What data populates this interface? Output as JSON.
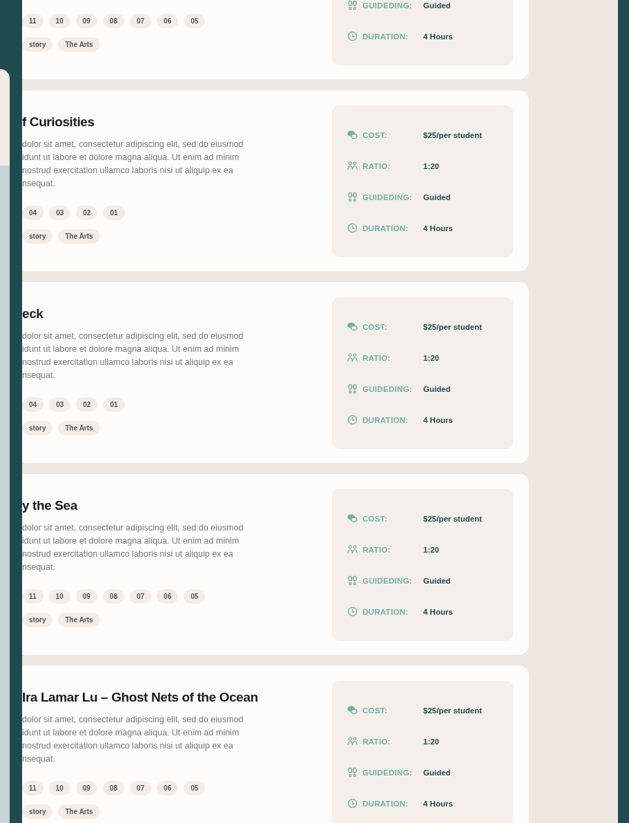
{
  "cards": [
    {
      "numbers": [
        "11",
        "10",
        "09",
        "08",
        "07",
        "06",
        "05"
      ],
      "tags": [
        "story",
        "The Arts"
      ],
      "details": [
        {
          "kind": "guided",
          "label": "GUIDEDING:",
          "value": "Guided"
        },
        {
          "kind": "duration",
          "label": "DURATION:",
          "value": "4 Hours"
        }
      ]
    },
    {
      "title": "f Curiosities",
      "description": "dolor sit amet, consectetur adipiscing elit, sed do eiusmod\nidunt ut labore et dolore magna aliqua. Ut enim ad minim\nnostrud exercitation ullamco laboris nisi ut aliquip ex ea\nnsequat.",
      "numbers": [
        "04",
        "03",
        "02",
        "01"
      ],
      "tags": [
        "story",
        "The Arts"
      ],
      "details": [
        {
          "kind": "cost",
          "label": "COST:",
          "value": "$25/per student"
        },
        {
          "kind": "ratio",
          "label": "RATIO:",
          "value": "1:20"
        },
        {
          "kind": "guided",
          "label": "GUIDEDING:",
          "value": "Guided"
        },
        {
          "kind": "duration",
          "label": "DURATION:",
          "value": "4 Hours"
        }
      ]
    },
    {
      "title": "eck",
      "description": "dolor sit amet, consectetur adipiscing elit, sed do eiusmod\nidunt ut labore et dolore magna aliqua. Ut enim ad minim\nnostrud exercitation ullamco laboris nisi ut aliquip ex ea\nnsequat.",
      "numbers": [
        "04",
        "03",
        "02",
        "01"
      ],
      "tags": [
        "story",
        "The Arts"
      ],
      "details": [
        {
          "kind": "cost",
          "label": "COST:",
          "value": "$25/per student"
        },
        {
          "kind": "ratio",
          "label": "RATIO:",
          "value": "1:20"
        },
        {
          "kind": "guided",
          "label": "GUIDEDING:",
          "value": "Guided"
        },
        {
          "kind": "duration",
          "label": "DURATION:",
          "value": "4 Hours"
        }
      ]
    },
    {
      "title": "y the Sea",
      "description": "dolor sit amet, consectetur adipiscing elit, sed do eiusmod\nidunt ut labore et dolore magna aliqua. Ut enim ad minim\nnostrud exercitation ullamco laboris nisi ut aliquip ex ea\nnsequat.",
      "numbers": [
        "11",
        "10",
        "09",
        "08",
        "07",
        "06",
        "05"
      ],
      "tags": [
        "story",
        "The Arts"
      ],
      "details": [
        {
          "kind": "cost",
          "label": "COST:",
          "value": "$25/per student"
        },
        {
          "kind": "ratio",
          "label": "RATIO:",
          "value": "1:20"
        },
        {
          "kind": "guided",
          "label": "GUIDEDING:",
          "value": "Guided"
        },
        {
          "kind": "duration",
          "label": "DURATION:",
          "value": "4 Hours"
        }
      ]
    },
    {
      "title": "Ira Lamar Lu – Ghost Nets of the Ocean",
      "description": "dolor sit amet, consectetur adipiscing elit, sed do eiusmod\nidunt ut labore et dolore magna aliqua. Ut enim ad minim\nnostrud exercitation ullamco laboris nisi ut aliquip ex ea\nnsequat.",
      "numbers": [
        "11",
        "10",
        "09",
        "08",
        "07",
        "06",
        "05"
      ],
      "tags": [
        "story",
        "The Arts"
      ],
      "details": [
        {
          "kind": "cost",
          "label": "COST:",
          "value": "$25/per student"
        },
        {
          "kind": "ratio",
          "label": "RATIO:",
          "value": "1:20"
        },
        {
          "kind": "guided",
          "label": "GUIDEDING:",
          "value": "Guided"
        },
        {
          "kind": "duration",
          "label": "DURATION:",
          "value": "4 Hours"
        }
      ]
    }
  ]
}
